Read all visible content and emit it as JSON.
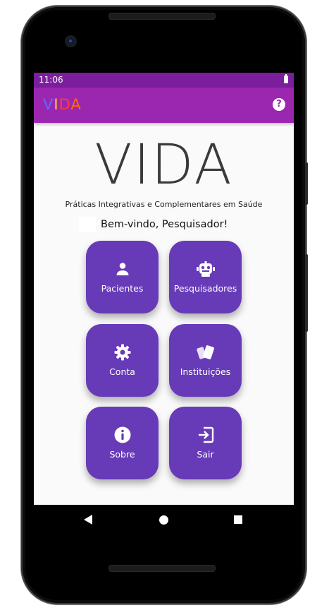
{
  "status_bar": {
    "time": "11:06"
  },
  "app_bar": {
    "logo_letters": [
      "V",
      "I",
      "D",
      "A"
    ],
    "logo_colors": [
      "#5b6cff",
      "#ffcc33",
      "#ff3b3b",
      "#ff6a00"
    ],
    "help_icon": "help-circle-icon"
  },
  "header": {
    "logo": "VIDA",
    "subtitle": "Práticas Integrativas e Complementares em Saúde",
    "welcome": "Bem-vindo, Pesquisador!"
  },
  "menu": [
    {
      "label": "Pacientes",
      "icon": "person-icon"
    },
    {
      "label": "Pesquisadores",
      "icon": "robot-icon"
    },
    {
      "label": "Conta",
      "icon": "gear-icon"
    },
    {
      "label": "Instituições",
      "icon": "cards-icon"
    },
    {
      "label": "Sobre",
      "icon": "info-icon"
    },
    {
      "label": "Sair",
      "icon": "exit-icon"
    }
  ],
  "colors": {
    "status_bar": "#7b1f9e",
    "app_bar": "#9b27b0",
    "tile": "#673ab7"
  }
}
